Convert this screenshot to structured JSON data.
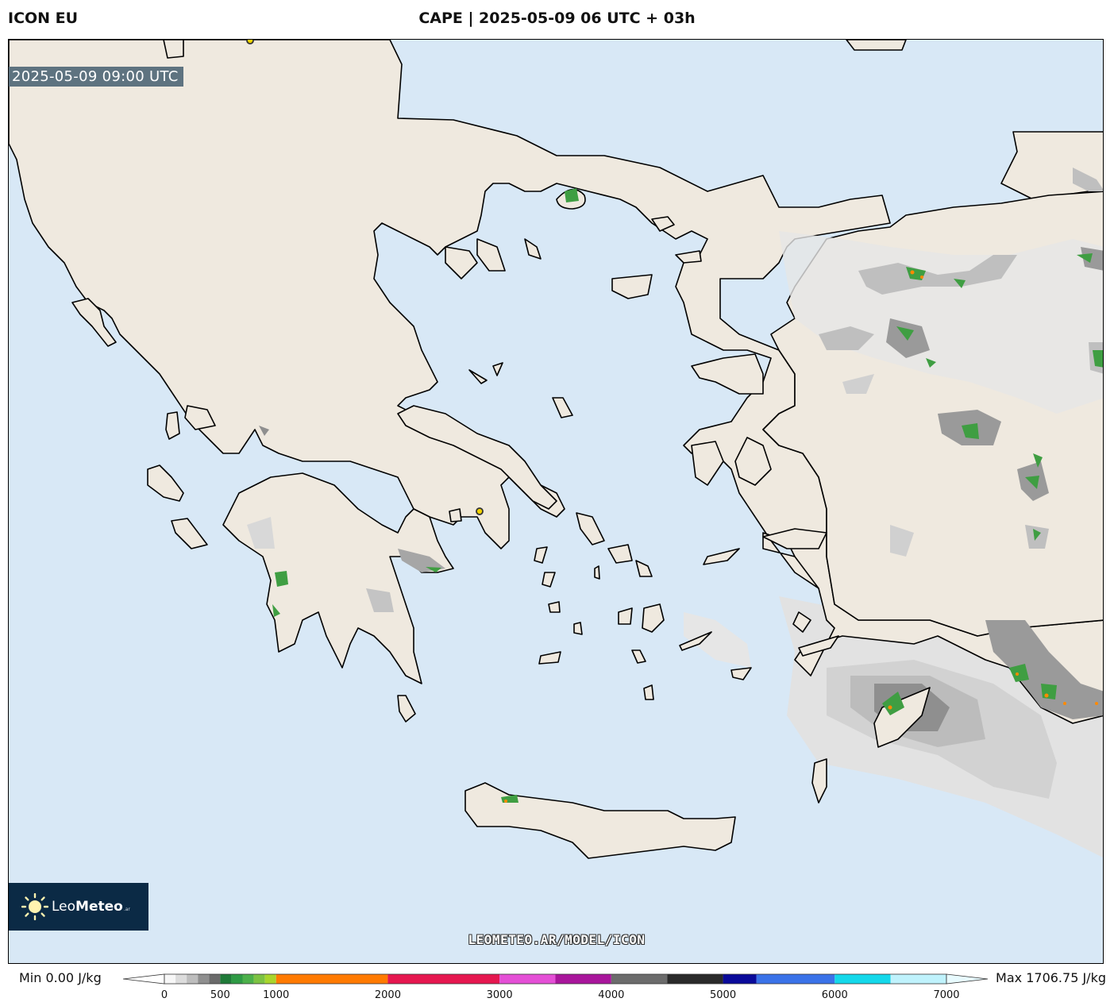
{
  "header": {
    "model": "ICON EU",
    "title": "CAPE | 2025-05-09 06 UTC + 03h"
  },
  "map": {
    "valid_time": "2025-05-09 09:00 UTC",
    "watermark": "LEOMETEO.AR/MODEL/ICON",
    "colors": {
      "sea": "#d8e8f6",
      "land": "#efe9df",
      "coast": "#000000",
      "city_marker": "#f1d200"
    }
  },
  "logo": {
    "name_light": "Leo",
    "name_bold": "Meteo",
    "suffix": ".ar"
  },
  "legend": {
    "min_label": "Min 0.00 J/kg",
    "max_label": "Max 1706.75 J/kg",
    "range": [
      0,
      7000
    ],
    "ticks": [
      "0",
      "500",
      "1000",
      "2000",
      "3000",
      "4000",
      "5000",
      "6000",
      "7000"
    ],
    "bands": [
      {
        "from": 0,
        "to": 100,
        "color": "#f7f7f7"
      },
      {
        "from": 100,
        "to": 200,
        "color": "#dcdcdc"
      },
      {
        "from": 200,
        "to": 300,
        "color": "#bdbdbd"
      },
      {
        "from": 300,
        "to": 400,
        "color": "#8f8f8f"
      },
      {
        "from": 400,
        "to": 500,
        "color": "#6a6a6a"
      },
      {
        "from": 500,
        "to": 600,
        "color": "#1f7a38"
      },
      {
        "from": 600,
        "to": 700,
        "color": "#2e9a44"
      },
      {
        "from": 700,
        "to": 800,
        "color": "#4cb04a"
      },
      {
        "from": 800,
        "to": 900,
        "color": "#7cc242"
      },
      {
        "from": 900,
        "to": 1000,
        "color": "#a8d52c"
      },
      {
        "from": 1000,
        "to": 2000,
        "color": "#ff7a00"
      },
      {
        "from": 2000,
        "to": 3000,
        "color": "#e5174f"
      },
      {
        "from": 3000,
        "to": 3500,
        "color": "#e44fd6"
      },
      {
        "from": 3500,
        "to": 4000,
        "color": "#a8159b"
      },
      {
        "from": 4000,
        "to": 4500,
        "color": "#6b6b6b"
      },
      {
        "from": 4500,
        "to": 5000,
        "color": "#2a2a2a"
      },
      {
        "from": 5000,
        "to": 5300,
        "color": "#0a0a9a"
      },
      {
        "from": 5300,
        "to": 6000,
        "color": "#3a72e8"
      },
      {
        "from": 6000,
        "to": 6500,
        "color": "#14d8ea"
      },
      {
        "from": 6500,
        "to": 7000,
        "color": "#bff2fc"
      }
    ]
  }
}
